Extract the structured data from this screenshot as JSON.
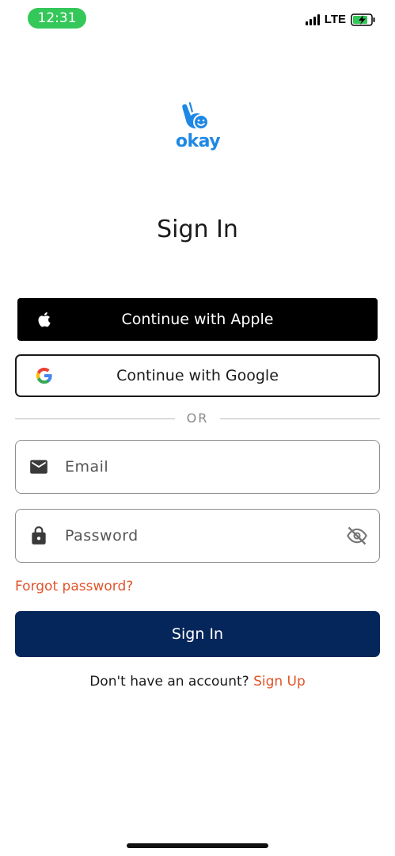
{
  "status_bar": {
    "time": "12:31",
    "network": "LTE",
    "time_pill_color": "#34c759",
    "battery_icon": "battery-charging-icon",
    "signal_icon": "cellular-signal-icon"
  },
  "logo": {
    "text": "okay",
    "color": "#1e88e5",
    "icon": "ok-hand-smiley-icon"
  },
  "page": {
    "title": "Sign In"
  },
  "social": {
    "apple_label": "Continue with Apple",
    "google_label": "Continue with Google",
    "apple_icon": "apple-logo-icon",
    "google_icon": "google-logo-icon"
  },
  "divider": {
    "label": "OR"
  },
  "form": {
    "email_placeholder": "Email",
    "email_value": "",
    "password_placeholder": "Password",
    "password_value": "",
    "email_icon": "envelope-icon",
    "password_icon": "lock-icon",
    "password_toggle_icon": "eye-off-icon",
    "forgot_label": "Forgot password?",
    "submit_label": "Sign In"
  },
  "footer": {
    "prompt": "Don't have an account? ",
    "signup_label": "Sign Up"
  },
  "colors": {
    "primary_navy": "#04265a",
    "accent_orange": "#e0552b",
    "apple_black": "#000000"
  }
}
